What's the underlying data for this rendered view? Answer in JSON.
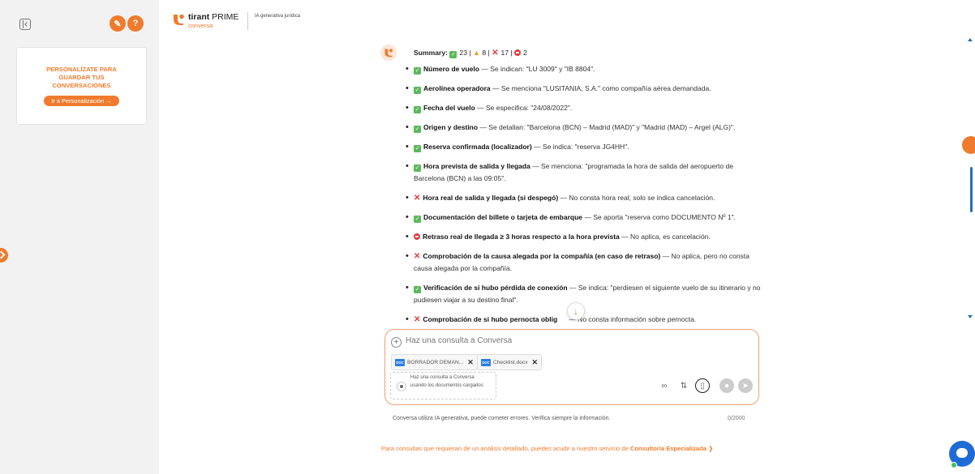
{
  "sidebar": {
    "promo_text": "PERSONALÍZATE PARA GUARDAR TUS CONVERSACIONES",
    "promo_button": "Ir a Personalización →"
  },
  "brand": {
    "name_bold": "tirant",
    "name_rest": " PRIME",
    "product": "conversa",
    "tag": "IA generativa jurídica"
  },
  "summary": {
    "label": "Summary:",
    "ok_count": "23",
    "warn_count": "8",
    "fail_count": "17",
    "stop_count": "2"
  },
  "items": [
    {
      "status": "ok",
      "title": "Número de vuelo",
      "text": " — Se indican: \"LU 3009\" y \"IB 8804\"."
    },
    {
      "status": "ok",
      "title": "Aerolínea operadora",
      "text": " — Se menciona \"LUSITANIA, S.A.\" como compañía aérea demandada."
    },
    {
      "status": "ok",
      "title": "Fecha del vuelo",
      "text": " — Se especifica: \"24/08/2022\"."
    },
    {
      "status": "ok",
      "title": "Origen y destino",
      "text": " — Se detallan: \"Barcelona (BCN) – Madrid (MAD)\" y \"Madrid (MAD) – Argel (ALG)\"."
    },
    {
      "status": "ok",
      "title": "Reserva confirmada (localizador)",
      "text": " — Se indica: \"reserva JG4HH\"."
    },
    {
      "status": "ok",
      "title": "Hora prevista de salida y llegada",
      "text": " — Se menciona: \"programada la hora de salida del aeropuerto de Barcelona (BCN) a las 09:05\"."
    },
    {
      "status": "fail",
      "title": "Hora real de salida y llegada (si despegó)",
      "text": " — No consta hora real; solo se indica cancelación."
    },
    {
      "status": "ok",
      "title": "Documentación del billete o tarjeta de embarque",
      "text": " — Se aporta \"reserva como DOCUMENTO Nº 1\"."
    },
    {
      "status": "stop",
      "title": "Retraso real de llegada ≥ 3 horas respecto a la hora prevista",
      "text": " — No aplica, es cancelación."
    },
    {
      "status": "fail",
      "title": "Comprobación de la causa alegada por la compañía (en caso de retraso)",
      "text": " — No aplica, pero no consta causa alegada por la compañía."
    },
    {
      "status": "ok",
      "title": "Verificación de si hubo pérdida de conexión",
      "text": " — Se indica: \"perdiesen el siguiente vuelo de su itinerario y no pudiesen viajar a su destino final\"."
    },
    {
      "status": "fail",
      "title": "Comprobación de si hubo pernocta oblig",
      "text": "      — No consta información sobre pernocta."
    }
  ],
  "composer": {
    "placeholder": "Haz una consulta a Conversa",
    "attachments": [
      {
        "icon": "DOC",
        "name": "BORRADOR DEMAN..."
      },
      {
        "icon": "DOC",
        "name": "Checklist.docx"
      }
    ],
    "docs_toggle_label": "Haz una consulta a Conversa usando los documentos cargados"
  },
  "footer": {
    "disclaimer": "Conversa utiliza IA generativa, puede cometer errores. Verifica siempre la información.",
    "counter": "0/2000",
    "consult_text": "Para consultas que requieran de un análisis detallado, puedes acudir a nuestro servicio de ",
    "consult_link": "Consultoría Especializada"
  },
  "colors": {
    "accent": "#f07b2c",
    "ok": "#5cb85c",
    "fail": "#e03c3c",
    "warn": "#f0a020",
    "chat": "#1e6bd6"
  }
}
